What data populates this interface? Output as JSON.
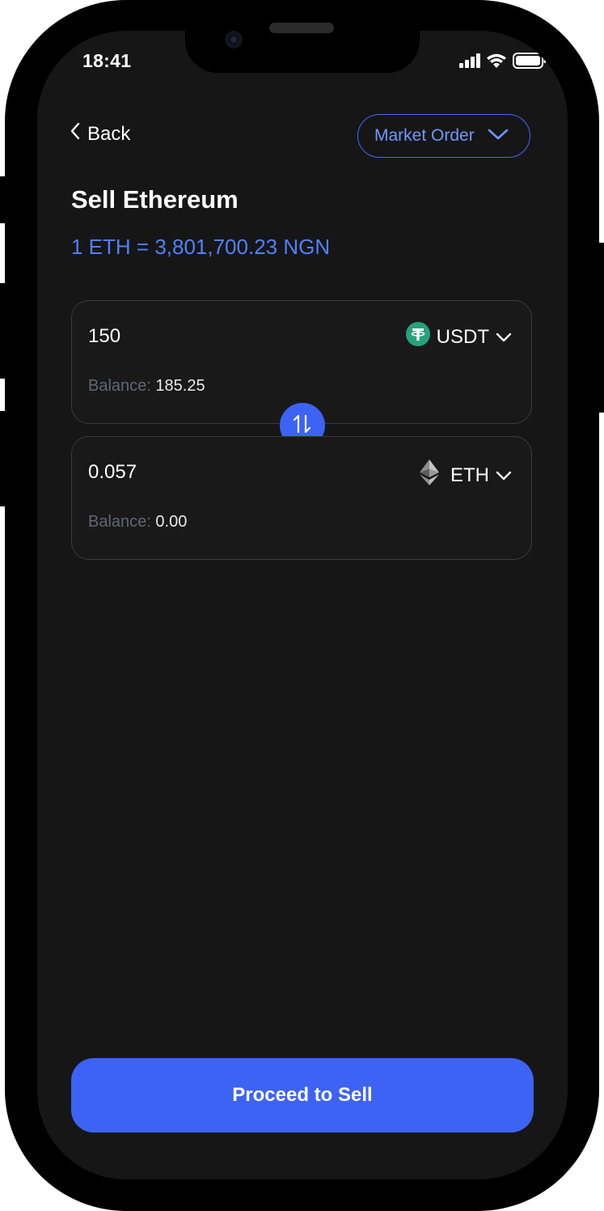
{
  "status_bar": {
    "time": "18:41"
  },
  "header": {
    "back_label": "Back",
    "order_type": "Market Order"
  },
  "page": {
    "title": "Sell Ethereum",
    "rate": "1 ETH = 3,801,700.23 NGN"
  },
  "from": {
    "amount": "150",
    "token": "USDT",
    "token_icon": "tether-icon",
    "balance_label": "Balance:",
    "balance_value": "185.25"
  },
  "to": {
    "amount": "0.057",
    "token": "ETH",
    "token_icon": "ethereum-icon",
    "balance_label": "Balance:",
    "balance_value": "0.00"
  },
  "actions": {
    "proceed_label": "Proceed to Sell"
  },
  "colors": {
    "background": "#161616",
    "accent": "#3d63f5",
    "accent_text": "#4f80ff",
    "tether": "#26a17b"
  }
}
